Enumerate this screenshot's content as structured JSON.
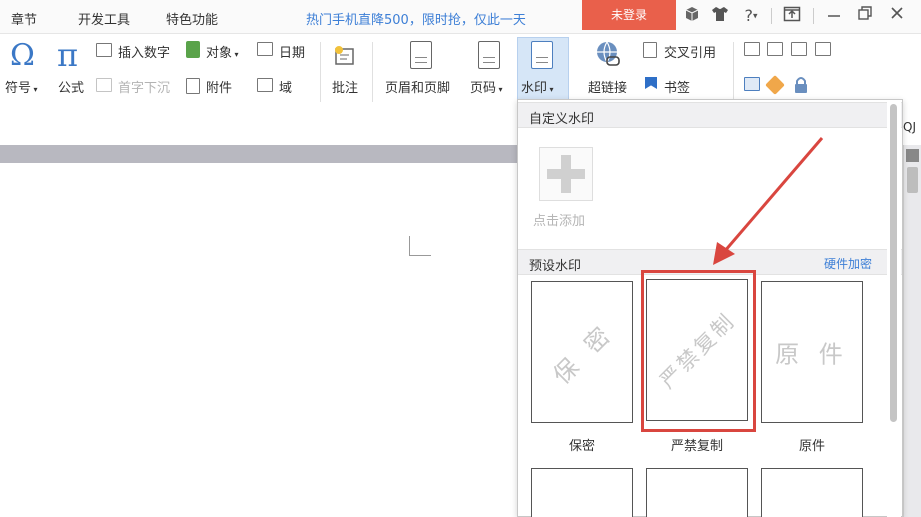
{
  "menubar": {
    "items": [
      "章节",
      "开发工具",
      "特色功能"
    ],
    "promo": "热门手机直降500，限时抢，仅此一天",
    "login_label": "未登录",
    "icons": [
      "cube-icon",
      "shirt-icon",
      "help-icon",
      "restore-icon",
      "minimize-icon",
      "maximize-icon",
      "close-icon"
    ],
    "help_label": "?"
  },
  "ribbon": {
    "symbol_label": "符号",
    "formula_label": "公式",
    "insert_number": "插入数字",
    "first_char_drop": "首字下沉",
    "object_label": "对象",
    "attachment_label": "附件",
    "date_label": "日期",
    "field_label": "域",
    "comment_label": "批注",
    "header_footer_label": "页眉和页脚",
    "page_number_label": "页码",
    "watermark_label": "水印",
    "hyperlink_label": "超链接",
    "cross_ref_label": "交叉引用",
    "bookmark_label": "书签",
    "qj_label": "QJ"
  },
  "watermark_panel": {
    "custom_section_title": "自定义水印",
    "add_label": "点击添加",
    "preset_section_title": "预设水印",
    "hardware_encrypt_link": "硬件加密",
    "presets": [
      {
        "caption": "保密",
        "watermark_text": "保 密"
      },
      {
        "caption": "严禁复制",
        "watermark_text": "严禁复制"
      },
      {
        "caption": "原件",
        "watermark_text": "原 件"
      }
    ]
  },
  "colors": {
    "accent": "#3d7fd6",
    "login_bg": "#e9604b",
    "highlight": "#d9463f"
  }
}
